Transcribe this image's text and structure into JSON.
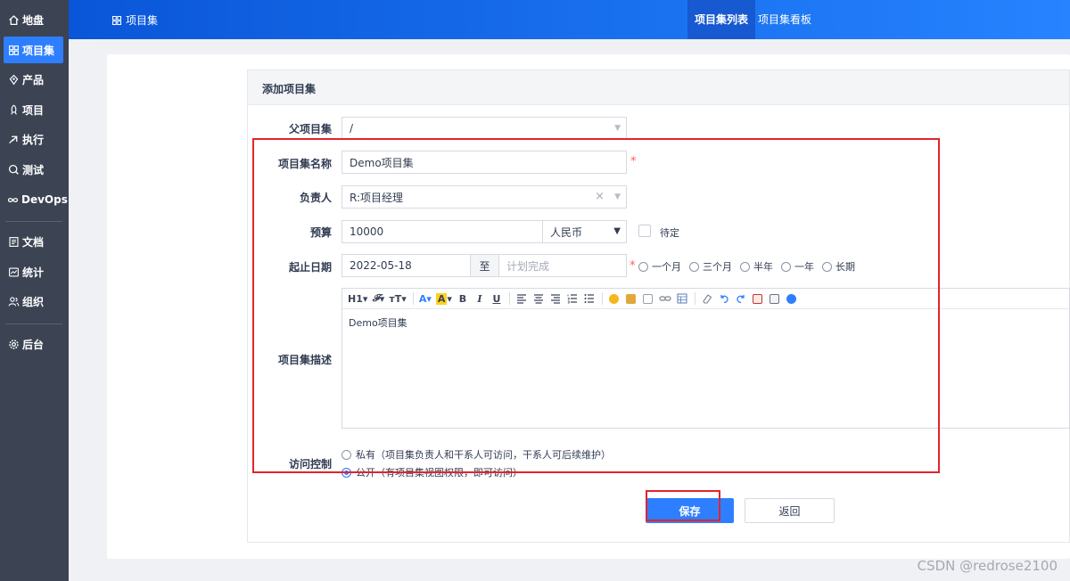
{
  "sidebar": {
    "items": [
      {
        "label": "地盘",
        "icon": "home-icon"
      },
      {
        "label": "项目集",
        "icon": "grid-icon"
      },
      {
        "label": "产品",
        "icon": "product-icon"
      },
      {
        "label": "项目",
        "icon": "project-icon"
      },
      {
        "label": "执行",
        "icon": "execution-icon"
      },
      {
        "label": "测试",
        "icon": "test-icon"
      },
      {
        "label": "DevOps",
        "icon": "infinity-icon"
      },
      {
        "label": "文档",
        "icon": "document-icon"
      },
      {
        "label": "统计",
        "icon": "chart-icon"
      },
      {
        "label": "组织",
        "icon": "people-icon"
      },
      {
        "label": "后台",
        "icon": "gear-icon"
      }
    ],
    "active_index": 1
  },
  "header": {
    "breadcrumb": "项目集",
    "tabs": [
      "项目集列表",
      "项目集看板"
    ],
    "active_tab": 0
  },
  "form": {
    "title": "添加项目集",
    "parent": {
      "label": "父项目集",
      "value": "/"
    },
    "name": {
      "label": "项目集名称",
      "value": "Demo项目集",
      "required_mark": "*"
    },
    "owner": {
      "label": "负责人",
      "value": "R:项目经理",
      "clear": "×"
    },
    "budget": {
      "label": "预算",
      "value": "10000",
      "currency": "人民币",
      "pending_label": "待定"
    },
    "dates": {
      "label": "起止日期",
      "begin": "2022-05-18",
      "separator": "至",
      "end_placeholder": "计划完成",
      "required_mark": "*",
      "quick_options": [
        "一个月",
        "三个月",
        "半年",
        "一年",
        "长期"
      ]
    },
    "description": {
      "label": "项目集描述",
      "content": "Demo项目集"
    },
    "access": {
      "label": "访问控制",
      "options": [
        {
          "text": "私有（项目集负责人和干系人可访问，干系人可后续维护）",
          "checked": false
        },
        {
          "text": "公开（有项目集视图权限，即可访问）",
          "checked": true
        }
      ]
    },
    "save_label": "保存",
    "back_label": "返回"
  },
  "editor_toolbar": {
    "heading": "H1",
    "font_family": "𝓕",
    "font_size": "ᴛT",
    "font_color": "A",
    "highlight": "A",
    "bold": "B",
    "italic": "I",
    "underline": "U"
  },
  "watermark": "CSDN @redrose2100",
  "colors": {
    "primary": "#2e7fff",
    "sidebar_bg": "#3c4353",
    "header_start": "#0a56d8",
    "header_end": "#2783ff",
    "required": "#ff5d5d",
    "annotation_red": "#e3242b"
  }
}
